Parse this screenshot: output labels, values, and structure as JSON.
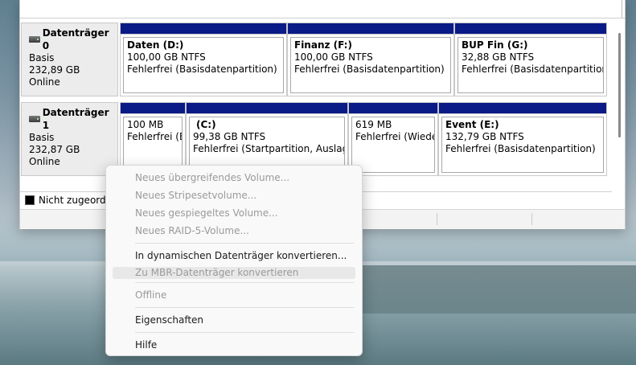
{
  "disks": [
    {
      "title": "Datenträger 0",
      "type": "Basis",
      "size": "232,89 GB",
      "status": "Online",
      "partitions": [
        {
          "name": "Daten  (D:)",
          "size": "100,00 GB NTFS",
          "state": "Fehlerfrei (Basisdatenpartition)"
        },
        {
          "name": "Finanz  (F:)",
          "size": "100,00 GB NTFS",
          "state": "Fehlerfrei (Basisdatenpartition)"
        },
        {
          "name": "BUP Fin  (G:)",
          "size": "32,88 GB NTFS",
          "state": "Fehlerfrei (Basisdatenpartition)"
        }
      ]
    },
    {
      "title": "Datenträger 1",
      "type": "Basis",
      "size": "232,87 GB",
      "status": "Online",
      "partitions": [
        {
          "name": "",
          "size": "100 MB",
          "state": "Fehlerfrei (EF"
        },
        {
          "name": "(C:)",
          "size": "99,38 GB NTFS",
          "state": "Fehlerfrei (Startpartition, Auslagerui"
        },
        {
          "name": "",
          "size": "619 MB",
          "state": "Fehlerfrei (Wiederh"
        },
        {
          "name": "Event  (E:)",
          "size": "132,79 GB NTFS",
          "state": "Fehlerfrei (Basisdatenpartition)"
        }
      ]
    }
  ],
  "legend": {
    "unallocated": "Nicht zugeordn"
  },
  "context_menu": {
    "new_spanned": "Neues übergreifendes Volume...",
    "new_striped": "Neues Stripesetvolume...",
    "new_mirrored": "Neues gespiegeltes Volume...",
    "new_raid5": "Neues RAID-5-Volume...",
    "convert_dynamic": "In dynamischen Datenträger konvertieren...",
    "convert_mbr": "Zu MBR-Datenträger konvertieren",
    "offline": "Offline",
    "properties": "Eigenschaften",
    "help": "Hilfe"
  },
  "colors": {
    "partition_bar": "#0a1a86",
    "menu_bg": "#f9f9f9"
  }
}
